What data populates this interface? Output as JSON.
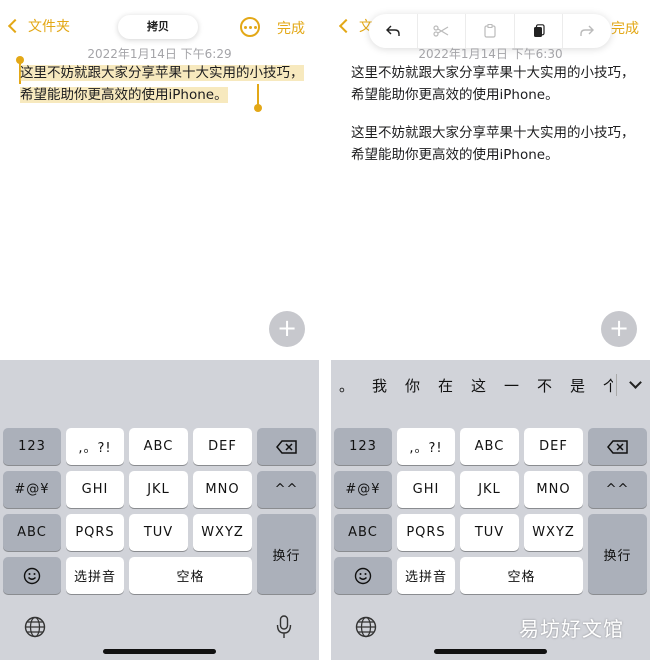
{
  "colors": {
    "accent": "#e3a817",
    "keyboard_bg": "#d1d3d9",
    "dark_key": "#abb0ba"
  },
  "left": {
    "back_label": "文件夹",
    "copy_popup": "拷贝",
    "done_label": "完成",
    "more_icon": "ellipsis-circle-icon",
    "date": "2022年1月14日 下午6:29",
    "selected_text": "这里不妨就跟大家分享苹果十大实用的小技巧，希望能助你更高效的使用iPhone。",
    "plus_label": "+"
  },
  "right": {
    "back_label": "文",
    "done_label": "完成",
    "date": "2022年1月14日 下午6:30",
    "edit_tools": [
      "undo-icon",
      "cut-icon",
      "paste-icon",
      "copy-icon",
      "redo-icon"
    ],
    "paragraphs": [
      "这里不妨就跟大家分享苹果十大实用的小技巧，希望能助你更高效的使用iPhone。",
      "这里不妨就跟大家分享苹果十大实用的小技巧，希望能助你更高效的使用iPhone。"
    ],
    "candidates": [
      "。",
      "我",
      "你",
      "在",
      "这",
      "一",
      "不",
      "是",
      "个"
    ],
    "plus_label": "+"
  },
  "keyboard": {
    "num": "123",
    "punct": ",。?!",
    "abc_key": "ABC",
    "def_key": "DEF",
    "symbols": "#@¥",
    "ghi": "GHI",
    "jkl": "JKL",
    "mno": "MNO",
    "emoticon": "^^",
    "abc_mode": "ABC",
    "pqrs": "PQRS",
    "tuv": "TUV",
    "wxyz": "WXYZ",
    "return_key": "换行",
    "select_pinyin": "选拼音",
    "space": "空格"
  },
  "watermark": "易坊好文馆"
}
